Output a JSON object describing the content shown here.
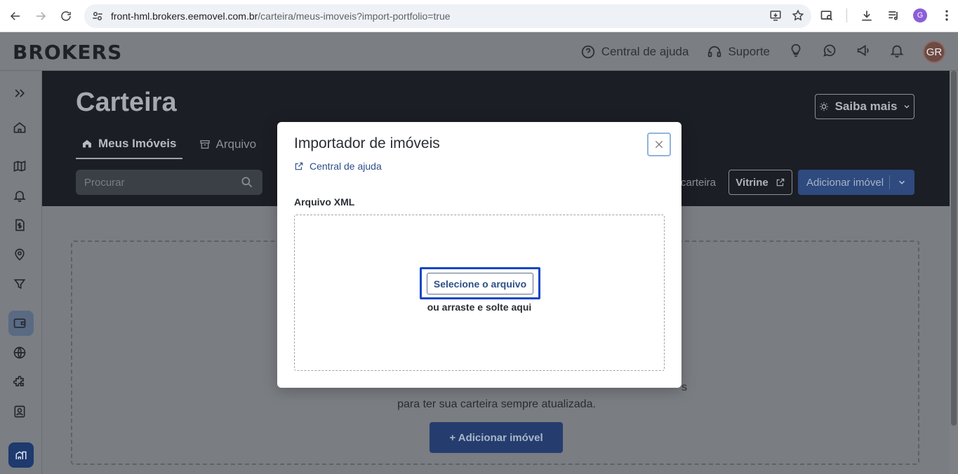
{
  "browser": {
    "url_host": "front-hml.brokers.eemovel.com.br",
    "url_path": "/carteira/meus-imoveis?import-portfolio=true",
    "profile_initial": "G"
  },
  "header": {
    "logo": "BROKERS",
    "help_label": "Central de ajuda",
    "support_label": "Suporte",
    "avatar_initials": "GR"
  },
  "page": {
    "title": "Carteira",
    "tabs": [
      {
        "label": "Meus Imóveis",
        "active": true
      },
      {
        "label": "Arquivo",
        "active": false
      }
    ],
    "search_placeholder": "Procurar",
    "saiba_mais_label": "Saiba mais",
    "carteira_partial": "carteira",
    "vitrine_label": "Vitrine",
    "add_property_label": "Adicionar imóvel"
  },
  "empty_state": {
    "line1": "s",
    "line2": "para ter sua carteira sempre atualizada.",
    "add_button_label": "+ Adicionar imóvel"
  },
  "modal": {
    "title": "Importador de imóveis",
    "help_link": "Central de ajuda",
    "field_label": "Arquivo XML",
    "select_button": "Selecione o arquivo",
    "drop_hint": "ou arraste e solte aqui"
  },
  "colors": {
    "accent": "#1447c4",
    "primary_button": "#2e4a7e",
    "link": "#2c4f88"
  }
}
